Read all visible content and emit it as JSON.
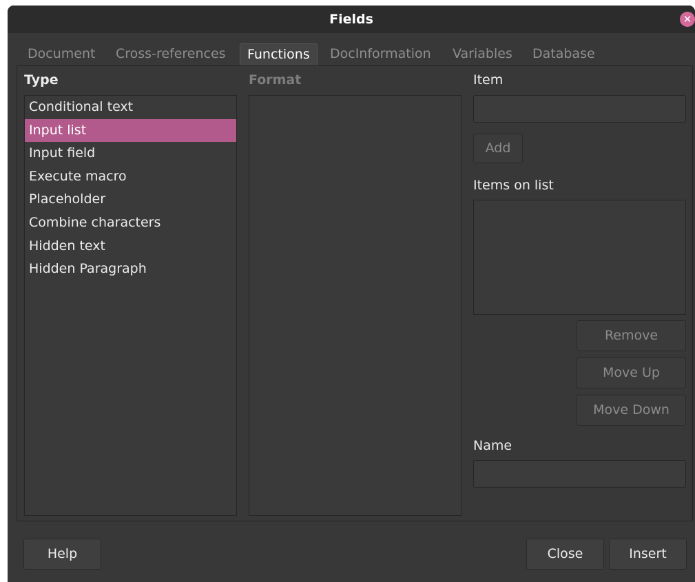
{
  "window": {
    "title": "Fields",
    "close_glyph": "✕"
  },
  "tabs": [
    {
      "label": "Document",
      "active": false
    },
    {
      "label": "Cross-references",
      "active": false
    },
    {
      "label": "Functions",
      "active": true
    },
    {
      "label": "DocInformation",
      "active": false
    },
    {
      "label": "Variables",
      "active": false
    },
    {
      "label": "Database",
      "active": false
    }
  ],
  "type_section": {
    "label": "Type",
    "items": [
      "Conditional text",
      "Input list",
      "Input field",
      "Execute macro",
      "Placeholder",
      "Combine characters",
      "Hidden text",
      "Hidden Paragraph"
    ],
    "selected": "Input list"
  },
  "format_section": {
    "label": "Format"
  },
  "item_section": {
    "label": "Item",
    "value": "",
    "add_label": "Add",
    "items_on_list_label": "Items on list",
    "remove_label": "Remove",
    "move_up_label": "Move Up",
    "move_down_label": "Move Down"
  },
  "name_section": {
    "label": "Name",
    "value": ""
  },
  "footer": {
    "help_label": "Help",
    "close_label": "Close",
    "insert_label": "Insert"
  },
  "colors": {
    "accent": "#b25a8c",
    "close_button": "#d36a9a",
    "background": "#383838"
  }
}
